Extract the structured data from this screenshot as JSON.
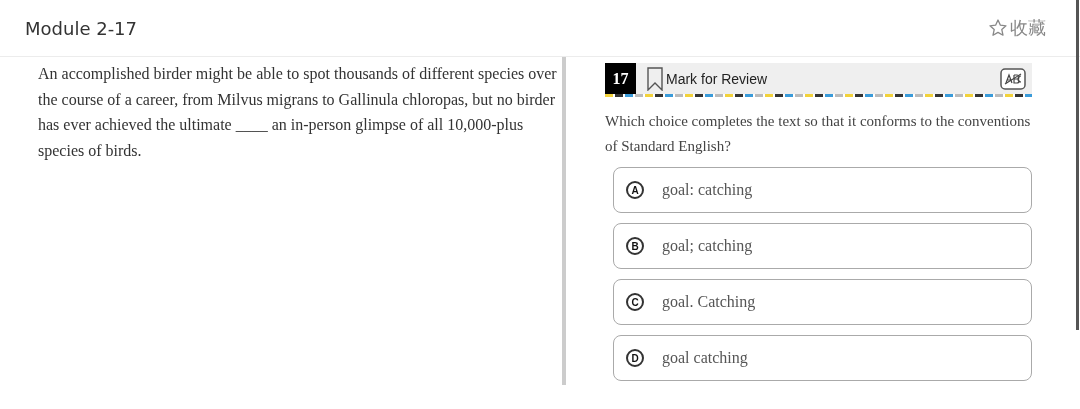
{
  "header": {
    "title": "Module 2-17",
    "favorite": {
      "label": "收藏",
      "on": false
    }
  },
  "passage": "An accomplished birder might be able to spot thousands of different species over the course of a career, from Milvus migrans to Gallinula chloropas, but no birder has ever achieved the ultimate ____ an in-person glimpse of all 10,000-plus species of birds.",
  "question": {
    "number": "17",
    "mark_for_review": {
      "label": "Mark for Review",
      "marked": false
    },
    "prompt": "Which choice completes the text so that it conforms to the conventions of Standard English?",
    "choices": [
      {
        "letter": "A",
        "text": "goal: catching",
        "selected": false
      },
      {
        "letter": "B",
        "text": "goal; catching",
        "selected": false
      },
      {
        "letter": "C",
        "text": "goal. Catching",
        "selected": false
      },
      {
        "letter": "D",
        "text": "goal catching",
        "selected": false
      }
    ]
  }
}
